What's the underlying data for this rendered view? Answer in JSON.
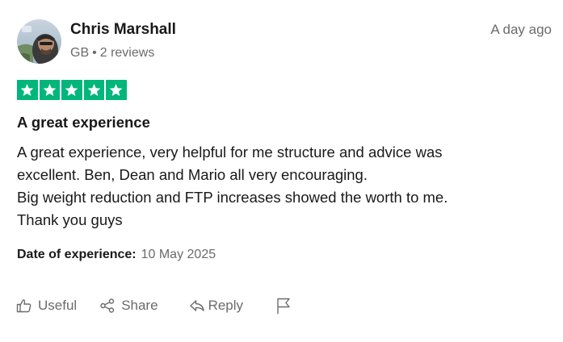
{
  "reviewer": {
    "name": "Chris Marshall",
    "country": "GB",
    "separator": "•",
    "reviews": "2 reviews"
  },
  "review": {
    "date": "A day ago",
    "rating": 5,
    "rating_color": "#00b67a",
    "title": "A great experience",
    "body_lines": [
      "A great experience, very helpful for me structure and advice was",
      "excellent. Ben, Dean and Mario all very encouraging.",
      "Big weight reduction and FTP increases showed the worth to me.",
      "Thank you guys"
    ],
    "experience_label": "Date of experience:",
    "experience_date": "10 May 2025"
  },
  "actions": {
    "useful": "Useful",
    "share": "Share",
    "reply": "Reply"
  },
  "icons": {
    "useful": "thumbs-up-icon",
    "share": "share-icon",
    "reply": "reply-icon",
    "report": "flag-icon"
  }
}
